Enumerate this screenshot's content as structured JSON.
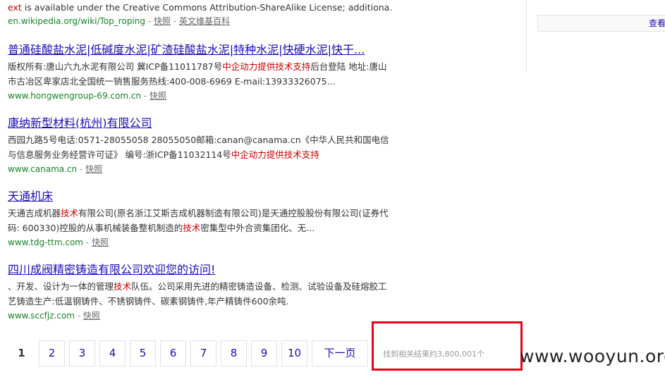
{
  "top_result": {
    "snippet_keyword": "ext",
    "snippet_rest": " is available under the Creative Commons Attribution-ShareAlike License; additiona...",
    "url": "en.wikipedia.org/wiki/Top_roping",
    "cache": "快照",
    "sep": " - ",
    "extra_link": "英文维基百科"
  },
  "results": [
    {
      "title": "普通硅酸盐水泥|低碱度水泥|矿渣硅酸盐水泥|特种水泥|快硬水泥|快干...",
      "desc_parts": [
        "版权所有:唐山六九水泥有限公司 冀ICP备11011787号",
        "中企动力提供技术支持",
        "后台登陆 地址:唐山市古冶区卑家店北全国统一销售服务热线:400-008-6969 E-mail:13933326075..."
      ],
      "url": "www.hongwengroup-69.com.cn",
      "cache": "快照"
    },
    {
      "title": "康纳新型材料(杭州)有限公司",
      "desc_parts": [
        "西园九路5号电话:0571-28055058 28055050邮箱:canan@canama.cn《中华人民共和国电信与信息服务业务经营许可证》 编号:浙ICP备11032114号",
        "中企动力提供技术支持",
        ""
      ],
      "url": "www.canama.cn",
      "cache": "快照"
    },
    {
      "title": "天通机床",
      "desc_parts": [
        "天通吉成机器",
        "技术",
        "有限公司(原名浙江艾斯吉成机器制造有限公司)是天通控股股份有限公司(证券代码: 600330)控股的从事机械装备整机制造的",
        "技术",
        "密集型中外合资集团化、无..."
      ],
      "url": "www.tdg-ttm.com",
      "cache": "快照"
    },
    {
      "title": "四川成阀精密铸造有限公司欢迎您的访问!",
      "desc_parts": [
        "、开发、设计为一体的管理",
        "技术",
        "队伍。公司采用先进的精密铸造设备、检测、试验设备及硅熔胶工艺铸造生产:低温钢铸件、不锈钢铸件、碳素钢铸件,年产精铸件600余吨."
      ],
      "url": "www.sccfjz.com",
      "cache": "快照"
    }
  ],
  "right_panel": {
    "link": "查看"
  },
  "pager": {
    "pages": [
      "1",
      "2",
      "3",
      "4",
      "5",
      "6",
      "7",
      "8",
      "9",
      "10"
    ],
    "next": "下一页"
  },
  "result_count": "找到相关结果约3,800,001个",
  "watermark": "www.wooyun.org",
  "colors": {
    "link": "#1a0dab",
    "url_green": "#188028",
    "highlight": "#c00000",
    "annotation_red": "#e8001c"
  }
}
